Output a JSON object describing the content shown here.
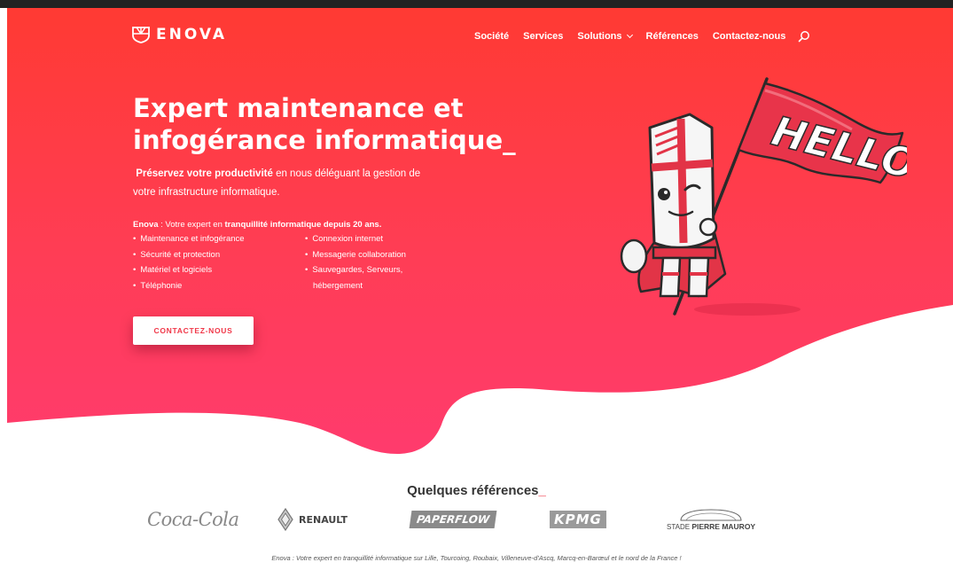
{
  "nav": {
    "logo_text": "ENOVA",
    "items": [
      {
        "label": "Société"
      },
      {
        "label": "Services"
      },
      {
        "label": "Solutions",
        "has_dropdown": true
      },
      {
        "label": "Références"
      },
      {
        "label": "Contactez-nous"
      }
    ],
    "search_icon": "search-icon"
  },
  "hero": {
    "title_line1": "Expert maintenance et",
    "title_line2": "infogérance informatique_",
    "intro_strong": "Préservez votre productivité",
    "intro_rest": " en nous déléguant la gestion de votre infrastructure informatique.",
    "tagline_brand": "Enova",
    "tagline_mid": " : Votre expert en ",
    "tagline_strong": "tranquillité informatique depuis 20 ans.",
    "services_left": [
      "Maintenance et infogérance",
      "Sécurité et protection",
      "Matériel et logiciels",
      "Téléphonie"
    ],
    "services_right": [
      "Connexion internet",
      "Messagerie collaboration",
      "Sauvegardes, Serveurs,",
      "hébergement"
    ],
    "cta_label": "CONTACTEZ-NOUS",
    "flag_text": "HELLO"
  },
  "references": {
    "title": "Quelques références",
    "title_suffix": "_",
    "logos": {
      "coca": "Coca-Cola",
      "renault": "RENAULT",
      "paperflow": "PAPERFLOW",
      "kpmg": "KPMG",
      "stade_prefix": "STADE ",
      "stade_strong": "PIERRE MAUROY"
    }
  },
  "footer": {
    "text": "Enova : Votre expert en tranquillité informatique sur Lille, Tourcoing, Roubaix, Villeneuve-d'Ascq, Marcq-en-Barœul et le nord de la France !"
  },
  "colors": {
    "hero_top": "#ff3b30",
    "hero_bottom": "#ff3a6a",
    "accent": "#f03748"
  }
}
